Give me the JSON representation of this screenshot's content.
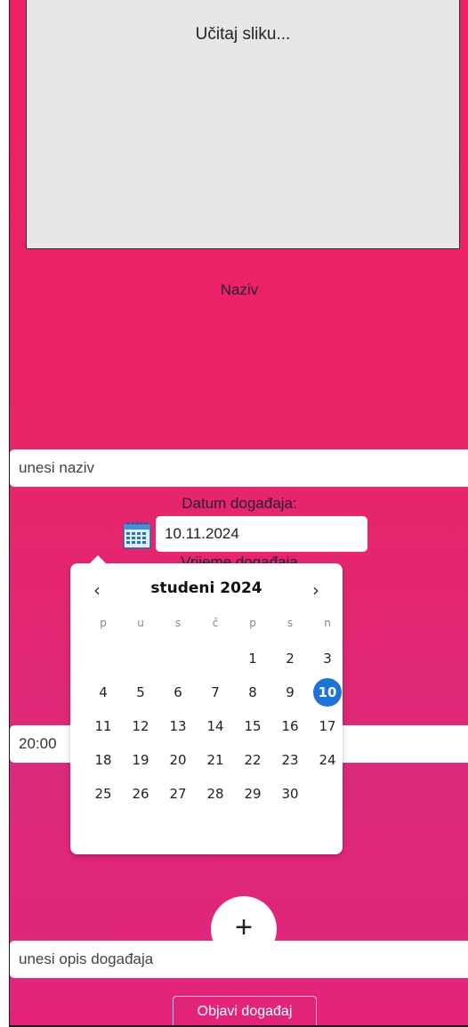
{
  "image_upload": {
    "label": "Učitaj sliku..."
  },
  "name": {
    "label": "Naziv",
    "placeholder": "unesi naziv"
  },
  "date": {
    "label": "Datum događaja:",
    "value": "10.11.2024"
  },
  "time": {
    "label": "Vrijeme događaja",
    "value": "20:00"
  },
  "datepicker": {
    "month_title": "studeni 2024",
    "prev": "‹",
    "next": "›",
    "weekdays": [
      "p",
      "u",
      "s",
      "č",
      "p",
      "s",
      "n"
    ],
    "days": [
      1,
      2,
      3,
      4,
      5,
      6,
      7,
      8,
      9,
      10,
      11,
      12,
      13,
      14,
      15,
      16,
      17,
      18,
      19,
      20,
      21,
      22,
      23,
      24,
      25,
      26,
      27,
      28,
      29,
      30
    ],
    "leading_blanks": 4,
    "selected_day": 10,
    "accent_color": "#1f73d6"
  },
  "add_button": {
    "label": "+"
  },
  "description": {
    "placeholder": "unesi opis događaja"
  },
  "publish": {
    "label": "Objavi događaj"
  },
  "colors": {
    "background_top": "#ef1f63",
    "background_bottom": "#dc2a7c"
  }
}
